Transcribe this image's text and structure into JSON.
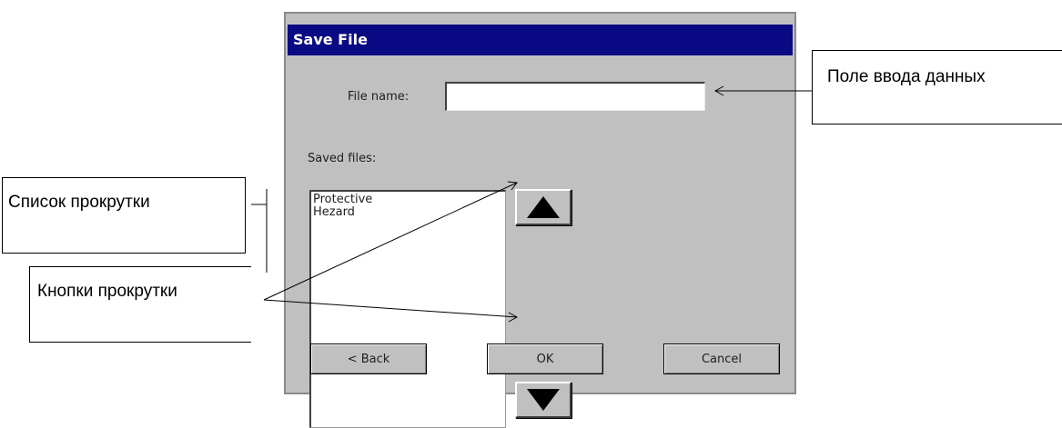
{
  "dialog": {
    "title": "Save File",
    "file_name_label": "File name:",
    "file_name_value": "",
    "saved_files_label": "Saved files:",
    "saved_files": [
      "Protective",
      "Hezard"
    ],
    "buttons": {
      "back": "< Back",
      "ok": "OK",
      "cancel": "Cancel"
    },
    "scroll_up_icon": "triangle-up-icon",
    "scroll_down_icon": "triangle-down-icon"
  },
  "callouts": {
    "input_field": "Поле ввода данных",
    "scroll_list": "Список прокрутки",
    "scroll_buttons": "Кнопки прокрутки"
  },
  "colors": {
    "titlebar": "#0a0a84",
    "dialog_bg": "#c0c0c0"
  }
}
